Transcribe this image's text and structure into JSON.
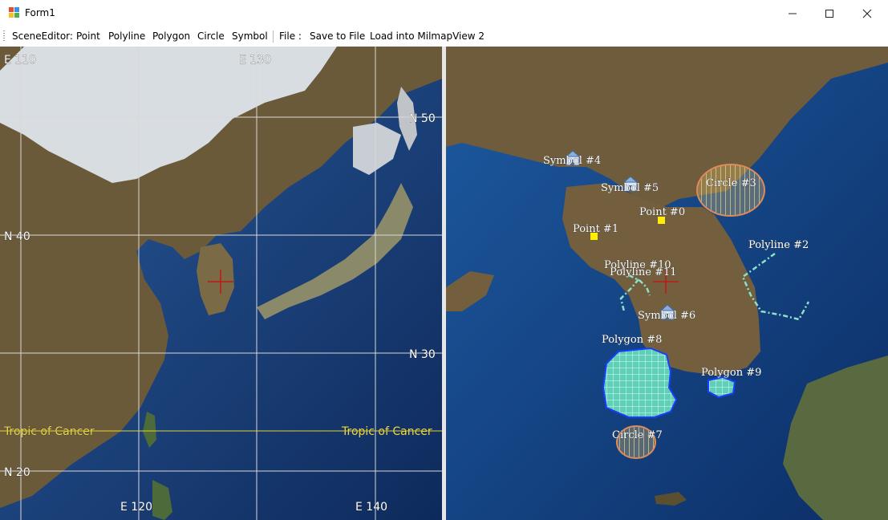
{
  "window": {
    "title": "Form1"
  },
  "menu": {
    "scene_editor": "SceneEditor:",
    "point": "Point",
    "polyline": "Polyline",
    "polygon": "Polygon",
    "circle": "Circle",
    "symbol": "Symbol",
    "file": "File :",
    "save_to_file": "Save to File",
    "load_into": "Load into MilmapView 2"
  },
  "left_map": {
    "grid_labels": {
      "e110": "E 110",
      "e130": "E 130",
      "n50": "N 50",
      "n40": "N 40",
      "n30": "N 30",
      "n20": "N 20",
      "e120": "E 120",
      "e140": "E 140",
      "tropic_left": "Tropic of Cancer",
      "tropic_right": "Tropic of Cancer"
    },
    "colors": {
      "grid": "#d8d8d8",
      "tropic": "#e0d23a",
      "crosshair": "#c01818"
    }
  },
  "right_map": {
    "objects": {
      "symbol4": "Symbol #4",
      "symbol5": "Symbol #5",
      "symbol6": "Symbol #6",
      "point0": "Point #0",
      "point1": "Point #1",
      "circle3": "Circle #3",
      "circle7": "Circle #7",
      "polyline2": "Polyline #2",
      "polyline10": "Polyline #10",
      "polyline11": "Polyline #11",
      "polygon8": "Polygon #8",
      "polygon9": "Polygon #9"
    },
    "colors": {
      "point": "#ffee00",
      "polyline": "#8fe0c8",
      "polygon_fill": "#5fd0b8",
      "polygon_border": "#1a3cff",
      "circle_border": "#e08a5a",
      "circle_hatch": "#f4e6a0"
    }
  }
}
